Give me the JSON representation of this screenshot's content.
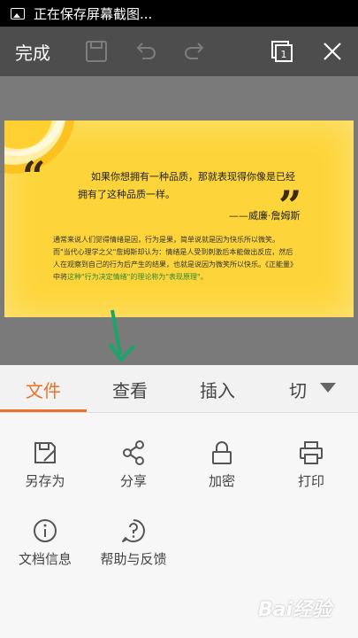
{
  "status_bar": {
    "text": "正在保存屏幕截图..."
  },
  "toolbar": {
    "done_label": "完成"
  },
  "document": {
    "quote_line1": "如果你想拥有一种品质，那就表现得你像是已经",
    "quote_line2": "拥有了这种品质一样。",
    "attribution": "——威廉·詹姆斯",
    "body_line1": "通常来说人们觉得情绪是因，行为是果，简单说就是因为快乐所以微笑。",
    "body_line2": "而\"当代心理学之父\"詹姆斯却认为：情绪是人受到刺激后本能做出反应，然后",
    "body_line3": "人在观察到自己的行为后产生的结果，也就是说因为微笑所以快乐。《正能量》",
    "body_line4_plain": "中将",
    "body_line4_green": "这种\"行为决定情绪\"的理论称为\"表现原理\"。"
  },
  "tabs": [
    {
      "label": "文件",
      "active": true
    },
    {
      "label": "查看",
      "active": false
    },
    {
      "label": "插入",
      "active": false
    },
    {
      "label": "切",
      "active": false
    }
  ],
  "actions": [
    {
      "label": "另存为",
      "icon": "save-as-icon"
    },
    {
      "label": "分享",
      "icon": "share-icon"
    },
    {
      "label": "加密",
      "icon": "lock-icon"
    },
    {
      "label": "打印",
      "icon": "printer-icon"
    },
    {
      "label": "文档信息",
      "icon": "info-icon"
    },
    {
      "label": "帮助与反馈",
      "icon": "help-icon"
    }
  ],
  "watermark": "Bai经验",
  "colors": {
    "accent": "#e8732a",
    "toolbar": "#4d4d4d",
    "doc_bg": "#fdd53a",
    "arrow": "#1aa56a"
  }
}
